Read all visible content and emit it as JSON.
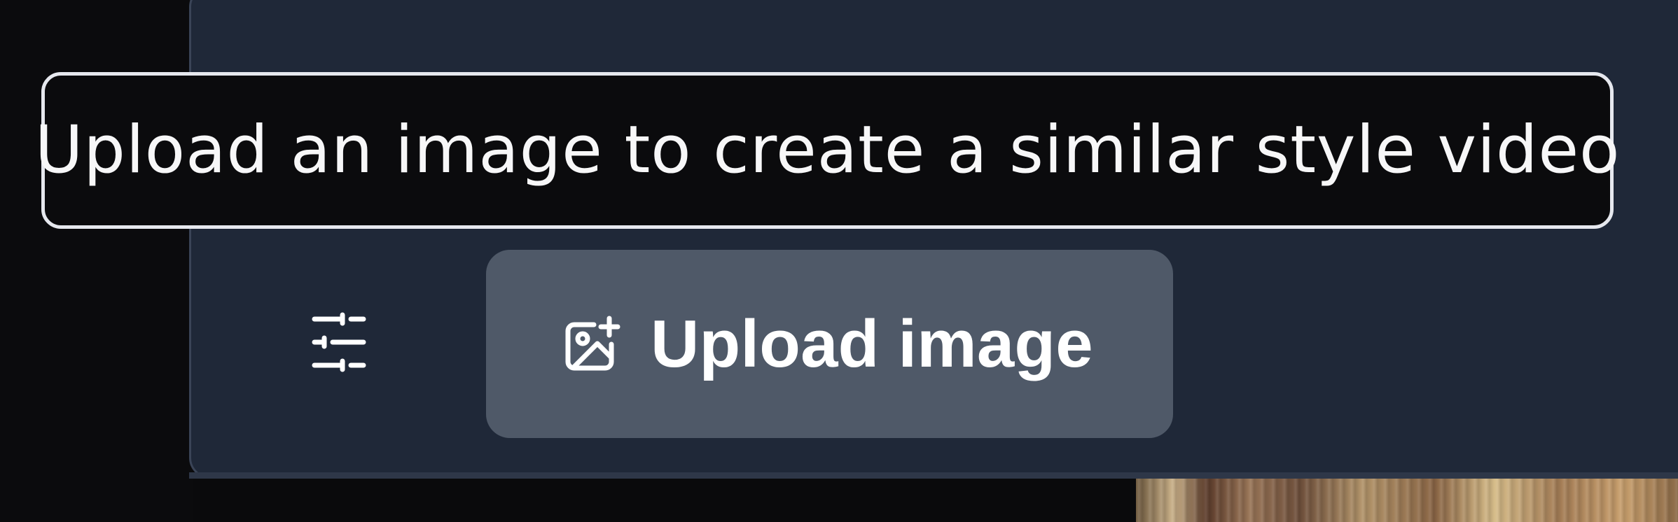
{
  "tooltip": {
    "text": "Upload an image to create a similar style video"
  },
  "controls": {
    "filters_icon": "sliders-icon",
    "upload_button": {
      "label": "Upload image",
      "icon": "image-plus-icon"
    }
  }
}
